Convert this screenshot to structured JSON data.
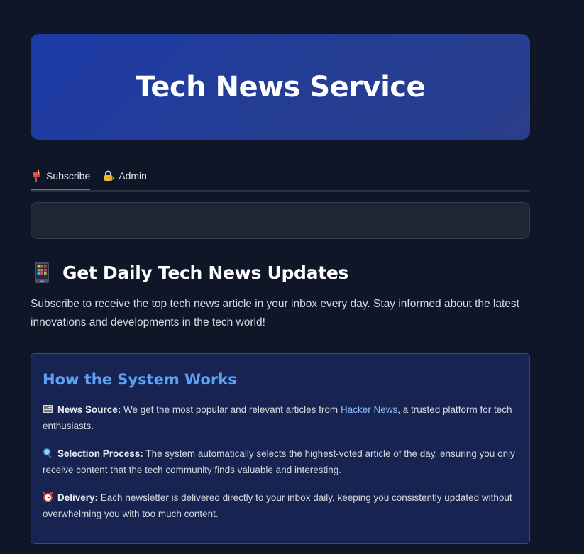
{
  "hero": {
    "title": "Tech News Service"
  },
  "tabs": [
    {
      "label": "Subscribe",
      "icon": "mailbox-icon",
      "active": true
    },
    {
      "label": "Admin",
      "icon": "lock-key-icon",
      "active": false
    }
  ],
  "main": {
    "heading": "Get Daily Tech News Updates",
    "heading_icon": "mobile-phone-icon",
    "intro": "Subscribe to receive the top tech news article in your inbox every day. Stay informed about the latest innovations and developments in the tech world!"
  },
  "info": {
    "title": "How the System Works",
    "items": [
      {
        "icon": "newspaper-icon",
        "label": "News Source:",
        "text_before": " We get the most popular and relevant articles from ",
        "link": "Hacker News",
        "text_after": ", a trusted platform for tech enthusiasts."
      },
      {
        "icon": "magnifier-icon",
        "label": "Selection Process:",
        "text": " The system automatically selects the highest-voted article of the day, ensuring you only receive content that the tech community finds valuable and interesting."
      },
      {
        "icon": "alarm-clock-icon",
        "label": "Delivery:",
        "text": " Each newsletter is delivered directly to your inbox daily, keeping you consistently updated without overwhelming you with too much content."
      }
    ]
  },
  "colors": {
    "background": "#0e1628",
    "hero": "#1d3aa8",
    "tab_active": "#ef4657",
    "info_bg": "#172451",
    "info_title": "#5aa2f5",
    "link": "#8ab8f8"
  }
}
